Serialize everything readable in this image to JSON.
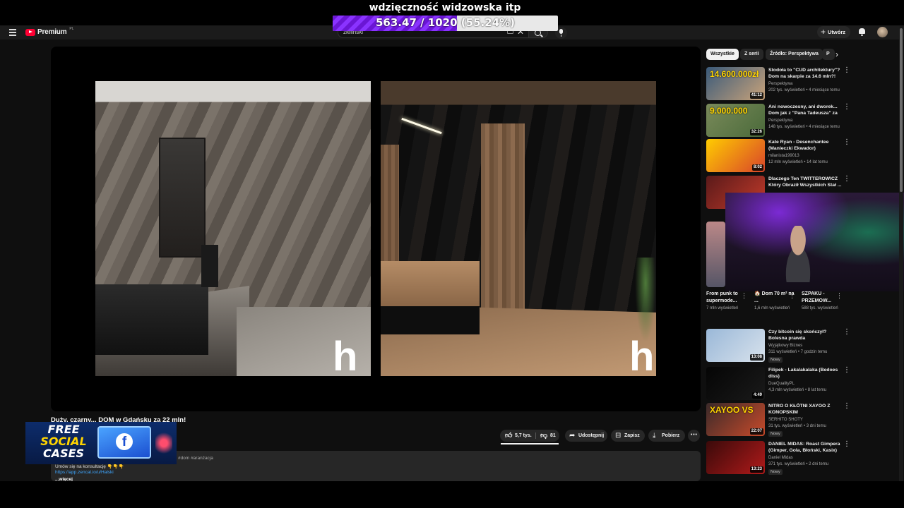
{
  "overlay": {
    "title": "wdzięczność widzowska itp",
    "value_text": "563.47 / 1020",
    "percent_text": "(55.24%)",
    "progress": 0.5524
  },
  "header": {
    "logo_text": "Premium",
    "logo_sup": "PL",
    "search_value": "zielinski",
    "create_label": "Utwórz"
  },
  "video": {
    "title": "Duży, czarny... DOM w Gdańsku za 22 mln!"
  },
  "actions": {
    "likes": "5,7 tys.",
    "dislikes": "81",
    "share": "Udostępnij",
    "save": "Zapisz",
    "download": "Pobierz"
  },
  "description": {
    "tags": "#dom #aranżacja",
    "line1": "Umów się na konsultację 👇👇👇",
    "link": "https://app.zencal.io/u/Halski",
    "more": "...więcej"
  },
  "promo": {
    "line1": "FREE",
    "line2": "SOCIAL",
    "line3": "CASES"
  },
  "chips": [
    "Wszystkie",
    "Z serii",
    "Źródło: Perspektywa",
    "P"
  ],
  "recommendations": [
    {
      "title": "Stodoła to \"CUD architektury\"? Dom na skarpie za 14.6 mln?!",
      "channel": "Perspektywa",
      "meta": "202 tys. wyświetleń • 4 miesiące temu",
      "duration": "41:12",
      "badge": "",
      "thumb_text": "14.600.000zł",
      "colors": [
        "#3a5a7a",
        "#c9a37a"
      ]
    },
    {
      "title": "Ani nowoczesny, ani dworek... Dom jak z \"Pana Tadeusza\" za ...",
      "channel": "Perspektywa",
      "meta": "148 tys. wyświetleń • 4 miesiące temu",
      "duration": "32:26",
      "badge": "",
      "thumb_text": "9.000.000",
      "colors": [
        "#7a8a5a",
        "#4a6a3a"
      ]
    },
    {
      "title": "Kate Ryan - Desenchantee (Manieczki Ekwador)",
      "channel": "milanista199013",
      "meta": "12 mln wyświetleń • 14 lat temu",
      "duration": "8:02",
      "badge": "",
      "thumb_text": "",
      "colors": [
        "#ffcc00",
        "#d9442a"
      ]
    },
    {
      "title": "Dlaczego Ten TWITTEROWICZ Który Obraził Wszystkich Stał ...",
      "channel": "",
      "meta": "",
      "duration": "",
      "badge": "",
      "thumb_text": "",
      "colors": [
        "#5a1a1a",
        "#c23a2a"
      ]
    },
    {
      "title": "Czy bitcoin się skończył? Bolesna prawda",
      "channel": "Wyjątkowy Biznes",
      "meta": "311 wyświetleń • 7 godzin temu",
      "duration": "13:08",
      "badge": "Nowy",
      "thumb_text": "",
      "colors": [
        "#9ab8d8",
        "#d8e2ec"
      ]
    },
    {
      "title": "Filipek - Lakalakalaka (Bedoes diss)",
      "channel": "DueQualityPL",
      "meta": "4,3 mln wyświetleń • 8 lat temu",
      "duration": "4:49",
      "badge": "",
      "thumb_text": "",
      "colors": [
        "#050505",
        "#1a1a1a"
      ]
    },
    {
      "title": "NITRO O KŁÓTNI XAYOO Z KONOPSKIM",
      "channel": "SERHITO SHOTY",
      "meta": "31 tys. wyświetleń • 3 dni temu",
      "duration": "22:07",
      "badge": "Nowy",
      "thumb_text": "XAYOO VS",
      "colors": [
        "#3a2a2a",
        "#c84a2a"
      ]
    },
    {
      "title": "DANIEL MIDAS: Roast Gimpera (Gimper, Gola, Błoński, Kasix) |...",
      "channel": "Daniel Midas",
      "meta": "371 tys. wyświetleń • 2 dni temu",
      "duration": "13:23",
      "badge": "Nowy",
      "thumb_text": "",
      "colors": [
        "#3a0a0a",
        "#b01a1a"
      ]
    }
  ],
  "shorts": [
    {
      "title": "From punk to supermode...",
      "views": "7 mln wyświetleń"
    },
    {
      "title": "🏠 Dom 70 m² na ...",
      "views": "1,6 mln wyświetleń"
    },
    {
      "title": "SZPAKU - PRZEMOW...",
      "views": "588 tys. wyświetleń"
    }
  ]
}
